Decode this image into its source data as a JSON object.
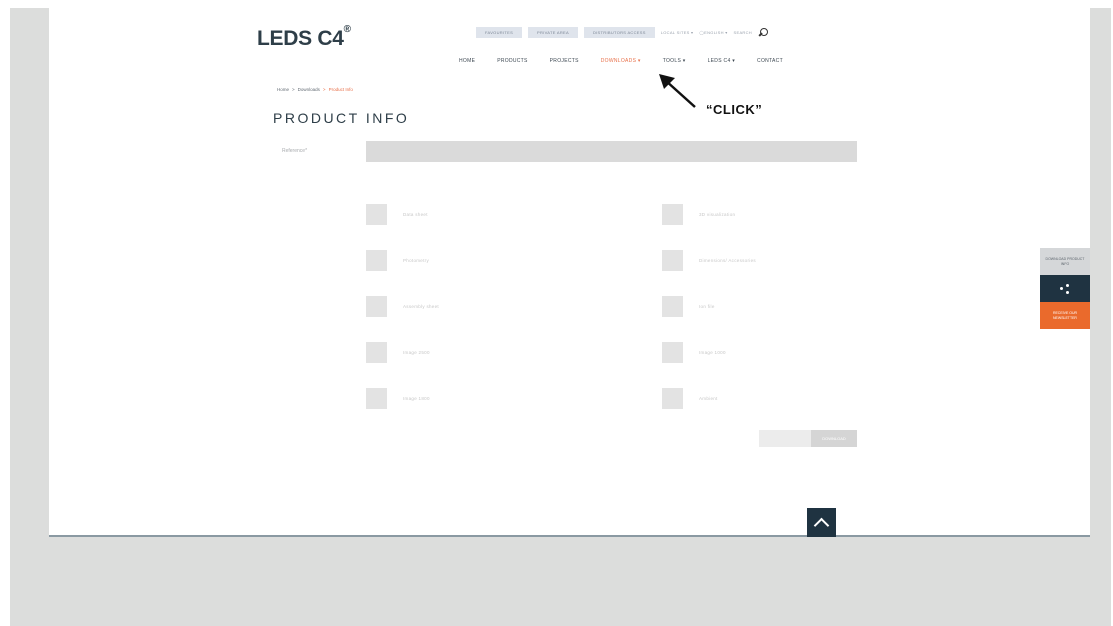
{
  "brand": {
    "logo": "LEDS C4",
    "logo_mark": "®"
  },
  "top_utilities": {
    "pills": [
      "FAVOURITES",
      "PRIVATE AREA",
      "DISTRIBUTORS ACCESS"
    ],
    "local_sites": "LOCAL SITES ▾",
    "language": "◯ENGLISH ▾",
    "search": "SEARCH"
  },
  "main_nav": [
    "HOME",
    "PRODUCTS",
    "PROJECTS",
    "DOWNLOADS ▾",
    "TOOLS ▾",
    "LEDS C4 ▾",
    "CONTACT"
  ],
  "breadcrumb": [
    "Home",
    ">",
    "Downloads",
    ">",
    "Product Info"
  ],
  "page_title": "PRODUCT INFO",
  "reference": {
    "label": "Reference*",
    "value": ""
  },
  "options_left": [
    "Data sheet",
    "Photometry",
    "Assembly sheet",
    "Image 2500",
    "Image 1800"
  ],
  "options_right": [
    "3D visualization",
    "Dimensions/ Accessories",
    "Ion file",
    "Image 1000",
    "Ambient"
  ],
  "download_button": "DOWNLOAD",
  "side_tabs": {
    "download": "DOWNLOAD PRODUCT INFO",
    "share_icon": "share-icon",
    "newsletter": "RECEIVE OUR NEWSLETTER"
  },
  "annotation": "“CLICK”",
  "colors": {
    "accent": "#e8704a",
    "dark": "#1f3341",
    "orange": "#ea6a2c"
  }
}
